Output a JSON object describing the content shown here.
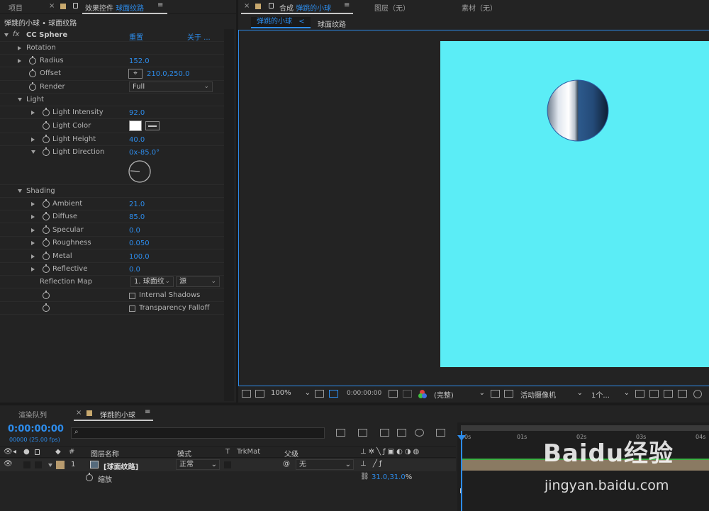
{
  "colors": {
    "accent": "#2d8ceb",
    "canvas": "#5bedf6",
    "panel": "#232323",
    "panel_dark": "#1c1c1c"
  },
  "top_panels": {
    "project_tab": "项目",
    "effect_controls_tab": "效果控件",
    "effect_controls_layer": "球面纹路",
    "composition_tab": "合成",
    "composition_name": "弹跳的小球",
    "layer_tab": "图层（无）",
    "footage_tab": "素材（无）",
    "close_glyph": "×",
    "menu_glyph": "≡"
  },
  "effect_controls": {
    "breadcrumb": "弹跳的小球 • 球面纹路",
    "effect_name": "CC Sphere",
    "fx_glyph": "fx",
    "reset_label": "重置",
    "about_label": "关于 ...",
    "props": {
      "rotation": {
        "label": "Rotation"
      },
      "radius": {
        "label": "Radius",
        "value": "152.0"
      },
      "offset": {
        "label": "Offset",
        "value": "210.0,250.0"
      },
      "render": {
        "label": "Render",
        "value": "Full"
      },
      "light": {
        "label": "Light"
      },
      "light_intensity": {
        "label": "Light Intensity",
        "value": "92.0"
      },
      "light_color": {
        "label": "Light Color",
        "color": "#ffffff"
      },
      "light_height": {
        "label": "Light Height",
        "value": "40.0"
      },
      "light_direction": {
        "label": "Light Direction",
        "value": "0x-85.0°"
      },
      "shading": {
        "label": "Shading"
      },
      "ambient": {
        "label": "Ambient",
        "value": "21.0"
      },
      "diffuse": {
        "label": "Diffuse",
        "value": "85.0"
      },
      "specular": {
        "label": "Specular",
        "value": "0.0"
      },
      "roughness": {
        "label": "Roughness",
        "value": "0.050"
      },
      "metal": {
        "label": "Metal",
        "value": "100.0"
      },
      "reflective": {
        "label": "Reflective",
        "value": "0.0"
      },
      "reflection_map": {
        "label": "Reflection Map",
        "layer_value": "1. 球面纹",
        "source_value": "源"
      },
      "internal_shadows": {
        "label": "Internal Shadows"
      },
      "transparency_falloff": {
        "label": "Transparency Falloff"
      }
    }
  },
  "composition": {
    "breadcrumb_active": "弹跳的小球",
    "breadcrumb_next": "球面纹路",
    "breadcrumb_sep": "<"
  },
  "viewer_toolbar": {
    "zoom": "100%",
    "timecode": "0:00:00:00",
    "resolution": "(完整)",
    "camera": "活动摄像机",
    "views": "1个..."
  },
  "timeline": {
    "render_queue_tab": "渲染队列",
    "comp_tab": "弹跳的小球",
    "current_time": "0:00:00:00",
    "frame_info": "00000 (25.00 fps)",
    "search_placeholder": "",
    "headers": {
      "number": "#",
      "layer_name": "图层名称",
      "mode": "模式",
      "t": "T",
      "trkmat": "TrkMat",
      "parent": "父级"
    },
    "layer": {
      "number": "1",
      "name": "[球面纹路]",
      "mode": "正常",
      "parent": "无"
    },
    "scale": {
      "label": "缩放",
      "value": "31.0,31.0",
      "unit": "%"
    },
    "ruler": [
      "0s",
      "01s",
      "02s",
      "03s",
      "04s"
    ]
  },
  "watermark": {
    "brand": "Baidu经验",
    "url": "jingyan.baidu.com"
  }
}
